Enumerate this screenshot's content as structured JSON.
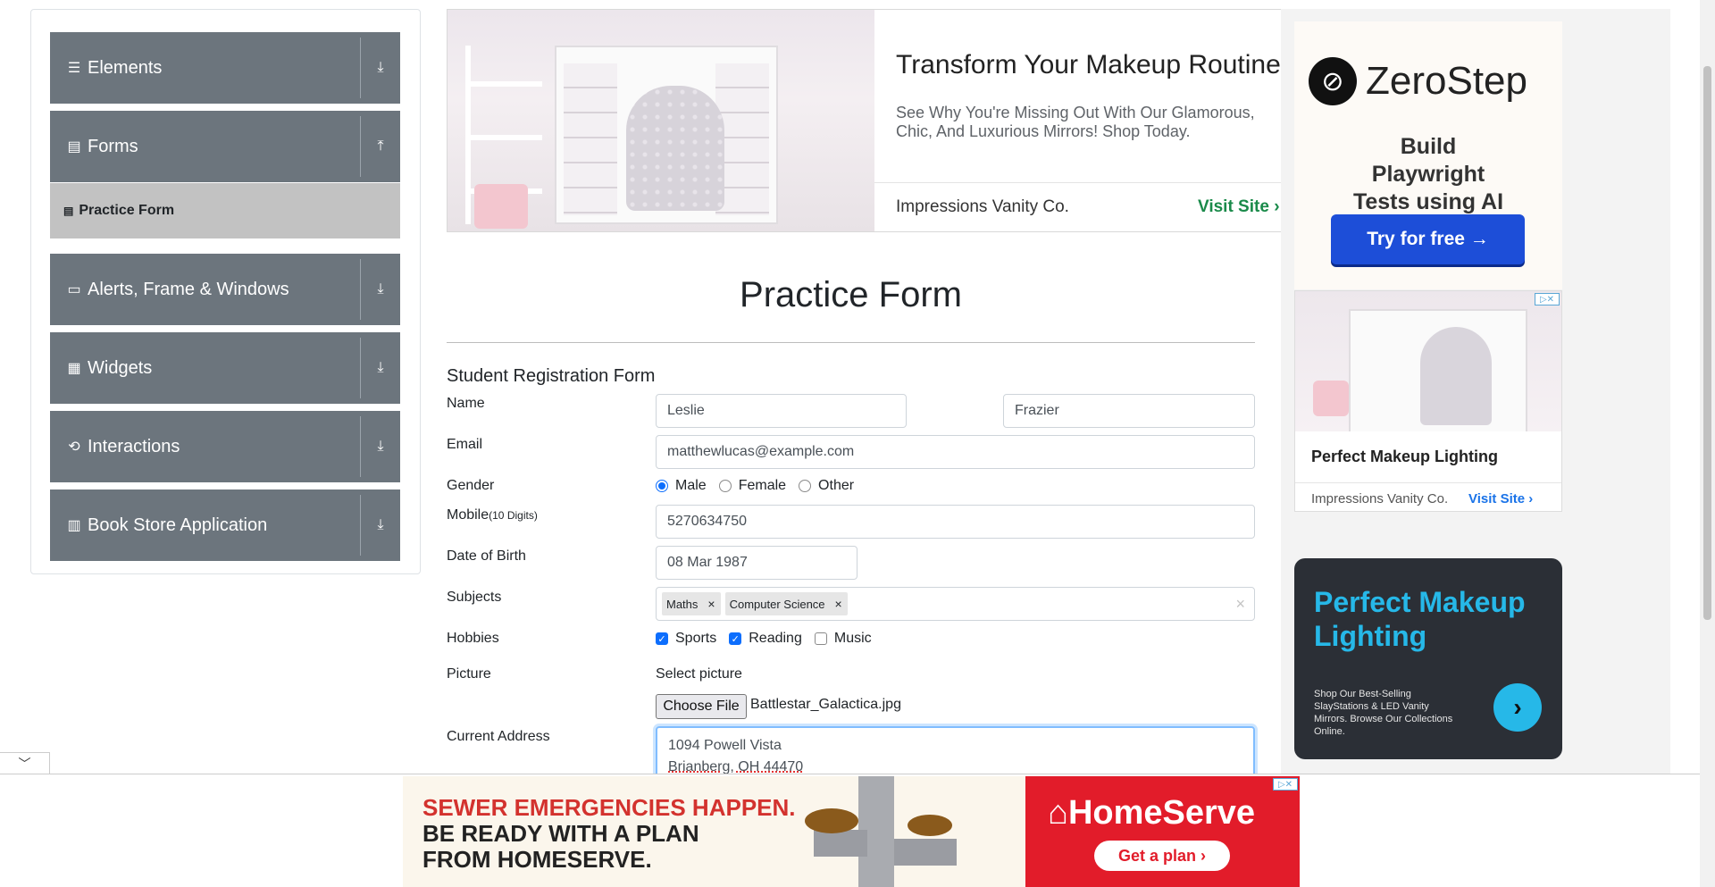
{
  "sidebar": {
    "groups": [
      {
        "label": "Elements",
        "icon": "hamburger-icon",
        "toggle": "download-arrow-icon"
      },
      {
        "label": "Forms",
        "icon": "document-icon",
        "toggle": "upload-arrow-icon"
      },
      {
        "label": "Alerts, Frame & Windows",
        "icon": "window-icon",
        "toggle": "download-arrow-icon"
      },
      {
        "label": "Widgets",
        "icon": "widgets-icon",
        "toggle": "download-arrow-icon"
      },
      {
        "label": "Interactions",
        "icon": "interactions-icon",
        "toggle": "download-arrow-icon"
      },
      {
        "label": "Book Store Application",
        "icon": "books-icon",
        "toggle": "download-arrow-icon"
      }
    ],
    "active_item": "Practice Form"
  },
  "top_ad": {
    "title": "Transform Your Makeup Routine",
    "description": "See Why You're Missing Out With Our Glamorous, Chic, And Luxurious Mirrors! Shop Today.",
    "advertiser": "Impressions Vanity Co.",
    "cta": "Visit Site"
  },
  "right_ads": {
    "zerostep": {
      "brand": "ZeroStep",
      "tagline": "Build Playwright Tests using AI",
      "cta": "Try for free →"
    },
    "mirror": {
      "title": "Perfect Makeup Lighting",
      "advertiser": "Impressions Vanity Co.",
      "cta": "Visit Site"
    },
    "slay": {
      "title": "Perfect Makeup Lighting",
      "description": "Shop Our Best-Selling SlayStations & LED Vanity Mirrors. Browse Our Collections Online."
    }
  },
  "form": {
    "page_title": "Practice Form",
    "form_title": "Student Registration Form",
    "labels": {
      "name": "Name",
      "email": "Email",
      "gender": "Gender",
      "mobile": "Mobile",
      "mobile_hint": "(10 Digits)",
      "dob": "Date of Birth",
      "subjects": "Subjects",
      "hobbies": "Hobbies",
      "picture": "Picture",
      "select_picture": "Select picture",
      "address": "Current Address"
    },
    "first_name": "Leslie",
    "last_name": "Frazier",
    "email": "matthewlucas@example.com",
    "gender_options": [
      "Male",
      "Female",
      "Other"
    ],
    "gender_selected": "Male",
    "mobile": "5270634750",
    "dob": "08 Mar 1987",
    "subjects": [
      "Maths",
      "Computer Science"
    ],
    "hobbies": [
      {
        "label": "Sports",
        "checked": true
      },
      {
        "label": "Reading",
        "checked": true
      },
      {
        "label": "Music",
        "checked": false
      }
    ],
    "file_button": "Choose File",
    "file_name": "Battlestar_Galactica.jpg",
    "address_line1": "1094 Powell Vista",
    "address_line2": "Brianberg, OH 44470"
  },
  "bottom_ad": {
    "line1": "SEWER EMERGENCIES HAPPEN.",
    "line2a": "BE READY WITH A PLAN",
    "line2b": "FROM HOMESERVE.",
    "brand": "HomeServe",
    "cta": "Get a plan ›"
  },
  "colors": {
    "sidebar_group": "#6c757d",
    "active_item": "#c2c2c2",
    "accent_blue": "#0d6efd",
    "homeserve_red": "#e21c2a"
  }
}
